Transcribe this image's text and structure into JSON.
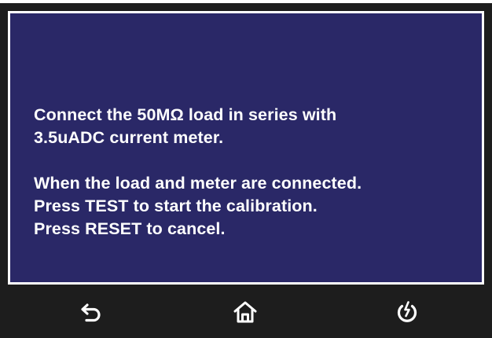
{
  "message": {
    "lines_block1": [
      "Connect the 50MΩ load in series with",
      "3.5uADC current meter."
    ],
    "lines_block2": [
      "When the load and meter are connected.",
      "Press TEST to start the calibration.",
      "Press RESET to cancel."
    ]
  },
  "nav": {
    "buttons": [
      {
        "icon": "back-arrow-icon"
      },
      {
        "icon": "home-icon"
      },
      {
        "icon": "power-icon"
      }
    ]
  },
  "colors": {
    "screen_bg": "#2a2867",
    "bezel": "#1d1d1d",
    "frame": "#ffffff",
    "text": "#ffffff"
  }
}
